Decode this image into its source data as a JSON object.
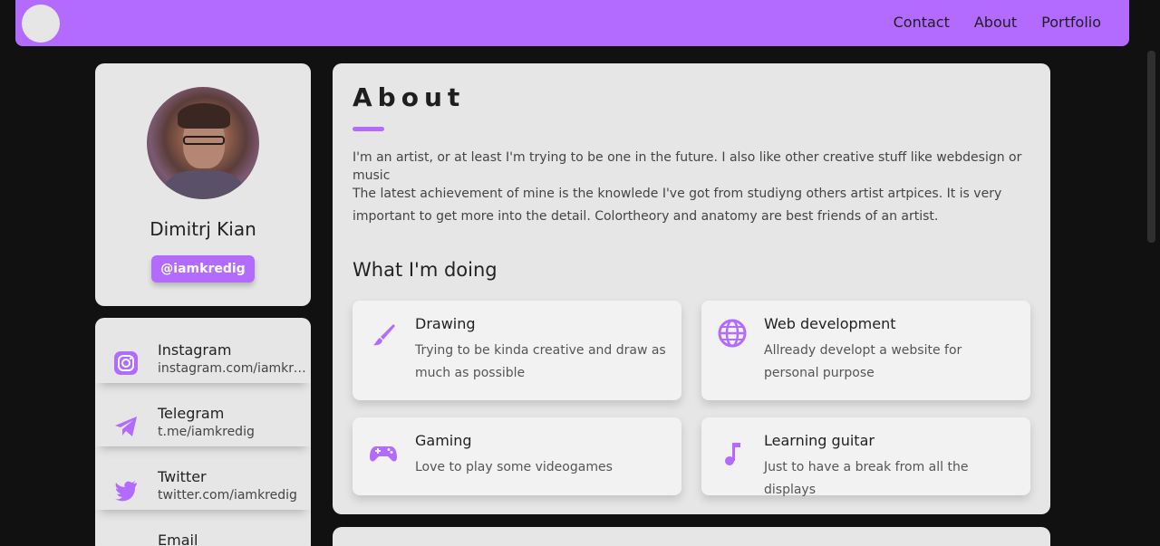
{
  "nav": {
    "links": [
      "Contact",
      "About",
      "Portfolio"
    ]
  },
  "profile": {
    "name": "Dimitrj Kian",
    "handle": "@iamkredig"
  },
  "socials": [
    {
      "title": "Instagram",
      "value": "instagram.com/iamkredig",
      "icon": "instagram-icon"
    },
    {
      "title": "Telegram",
      "value": "t.me/iamkredig",
      "icon": "telegram-icon"
    },
    {
      "title": "Twitter",
      "value": "twitter.com/iamkredig",
      "icon": "twitter-icon"
    },
    {
      "title": "Email",
      "value": "",
      "icon": "email-icon"
    }
  ],
  "about": {
    "title": "About",
    "paragraph1": "I'm an artist, or at least I'm trying to be one in the future. I also like other creative stuff like webdesign or music",
    "paragraph2": "The latest achievement of mine is the knowlede I've got from studiyng others artist artpices. It is very important to get more into the detail. Colortheory and anatomy are best friends of an artist.",
    "doing_title": "What I'm doing",
    "services": [
      {
        "title": "Drawing",
        "desc": "Trying to be kinda creative and draw as much as possible",
        "icon": "brush-icon"
      },
      {
        "title": "Web development",
        "desc": "Allready developt a website for personal purpose",
        "icon": "globe-icon"
      },
      {
        "title": "Gaming",
        "desc": "Love to play some videogames",
        "icon": "gamepad-icon"
      },
      {
        "title": "Learning guitar",
        "desc": "Just to have a break from all the displays",
        "icon": "music-note-icon"
      }
    ]
  },
  "colors": {
    "accent": "#b36bff",
    "background": "#111111",
    "card": "#e6e6e6"
  }
}
